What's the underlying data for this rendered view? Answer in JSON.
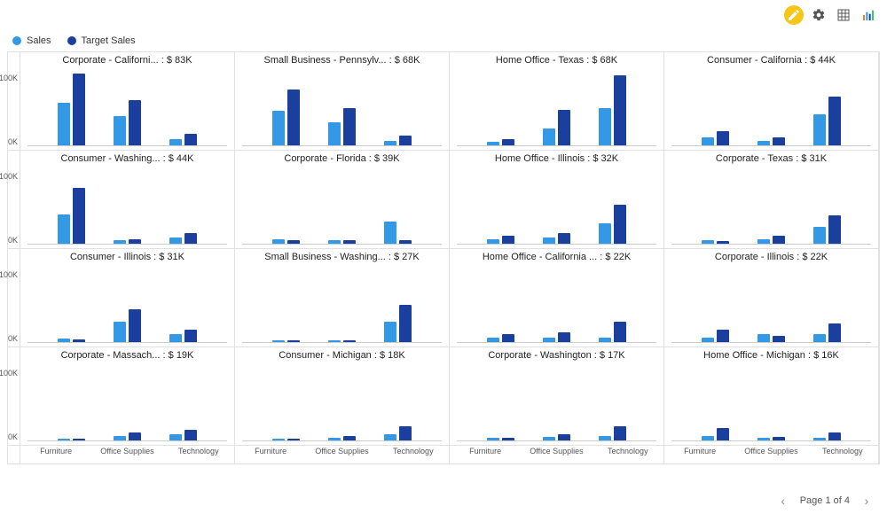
{
  "colors": {
    "sales": "#3399e6",
    "target": "#1b3f9c",
    "highlight": "#f5c518"
  },
  "legend": [
    {
      "label": "Sales",
      "color": "#3399e6"
    },
    {
      "label": "Target Sales",
      "color": "#1b3f9c"
    }
  ],
  "yaxis": {
    "max": 100,
    "ticks": [
      "100K",
      "0K"
    ]
  },
  "categories": [
    "Furniture",
    "Office Supplies",
    "Technology"
  ],
  "pager": {
    "label": "Page 1 of 4",
    "prev": "‹",
    "next": "›"
  },
  "chart_data": {
    "type": "bar",
    "layout": "small-multiples",
    "series_names": [
      "Sales",
      "Target Sales"
    ],
    "categories": [
      "Furniture",
      "Office Supplies",
      "Technology"
    ],
    "ylim": [
      0,
      100
    ],
    "yunit": "K",
    "panels": [
      {
        "title": "Corporate - Californi...",
        "value_label": "$ 83K",
        "series": [
          {
            "name": "Sales",
            "values": [
              55,
              38,
              8
            ]
          },
          {
            "name": "Target Sales",
            "values": [
              92,
              58,
              15
            ]
          }
        ]
      },
      {
        "title": "Small Business - Pennsylv...",
        "value_label": "$ 68K",
        "series": [
          {
            "name": "Sales",
            "values": [
              44,
              30,
              6
            ]
          },
          {
            "name": "Target Sales",
            "values": [
              72,
              48,
              12
            ]
          }
        ]
      },
      {
        "title": "Home Office - Texas",
        "value_label": "$ 68K",
        "series": [
          {
            "name": "Sales",
            "values": [
              4,
              22,
              48
            ]
          },
          {
            "name": "Target Sales",
            "values": [
              8,
              45,
              90
            ]
          }
        ]
      },
      {
        "title": "Consumer - California",
        "value_label": "$ 44K",
        "series": [
          {
            "name": "Sales",
            "values": [
              10,
              6,
              40
            ]
          },
          {
            "name": "Target Sales",
            "values": [
              18,
              10,
              62
            ]
          }
        ]
      },
      {
        "title": "Consumer - Washing...",
        "value_label": "$ 44K",
        "series": [
          {
            "name": "Sales",
            "values": [
              38,
              4,
              8
            ]
          },
          {
            "name": "Target Sales",
            "values": [
              72,
              6,
              14
            ]
          }
        ]
      },
      {
        "title": "Corporate - Florida",
        "value_label": "$ 39K",
        "series": [
          {
            "name": "Sales",
            "values": [
              6,
              5,
              28
            ]
          },
          {
            "name": "Target Sales",
            "values": [
              4,
              4,
              4
            ]
          }
        ]
      },
      {
        "title": "Home Office - Illinois",
        "value_label": "$ 32K",
        "series": [
          {
            "name": "Sales",
            "values": [
              6,
              8,
              26
            ]
          },
          {
            "name": "Target Sales",
            "values": [
              10,
              14,
              50
            ]
          }
        ]
      },
      {
        "title": "Corporate - Texas",
        "value_label": "$ 31K",
        "series": [
          {
            "name": "Sales",
            "values": [
              4,
              6,
              22
            ]
          },
          {
            "name": "Target Sales",
            "values": [
              3,
              10,
              36
            ]
          }
        ]
      },
      {
        "title": "Consumer - Illinois",
        "value_label": "$ 31K",
        "series": [
          {
            "name": "Sales",
            "values": [
              4,
              26,
              10
            ]
          },
          {
            "name": "Target Sales",
            "values": [
              3,
              42,
              16
            ]
          }
        ]
      },
      {
        "title": "Small Business - Washing...",
        "value_label": "$ 27K",
        "series": [
          {
            "name": "Sales",
            "values": [
              2,
              2,
              26
            ]
          },
          {
            "name": "Target Sales",
            "values": [
              2,
              2,
              48
            ]
          }
        ]
      },
      {
        "title": "Home Office - California ...",
        "value_label": "$ 22K",
        "series": [
          {
            "name": "Sales",
            "values": [
              6,
              6,
              6
            ]
          },
          {
            "name": "Target Sales",
            "values": [
              10,
              12,
              26
            ]
          }
        ]
      },
      {
        "title": "Corporate - Illinois",
        "value_label": "$ 22K",
        "series": [
          {
            "name": "Sales",
            "values": [
              6,
              10,
              10
            ]
          },
          {
            "name": "Target Sales",
            "values": [
              16,
              8,
              24
            ]
          }
        ]
      },
      {
        "title": "Corporate - Massach...",
        "value_label": "$ 19K",
        "series": [
          {
            "name": "Sales",
            "values": [
              2,
              6,
              8
            ]
          },
          {
            "name": "Target Sales",
            "values": [
              2,
              10,
              14
            ]
          }
        ]
      },
      {
        "title": "Consumer - Michigan",
        "value_label": "$ 18K",
        "series": [
          {
            "name": "Sales",
            "values": [
              2,
              3,
              8
            ]
          },
          {
            "name": "Target Sales",
            "values": [
              2,
              6,
              18
            ]
          }
        ]
      },
      {
        "title": "Corporate - Washington",
        "value_label": "$ 17K",
        "series": [
          {
            "name": "Sales",
            "values": [
              3,
              4,
              6
            ]
          },
          {
            "name": "Target Sales",
            "values": [
              3,
              8,
              18
            ]
          }
        ]
      },
      {
        "title": "Home Office - Michigan",
        "value_label": "$ 16K",
        "series": [
          {
            "name": "Sales",
            "values": [
              6,
              3,
              3
            ]
          },
          {
            "name": "Target Sales",
            "values": [
              16,
              4,
              10
            ]
          }
        ]
      }
    ]
  }
}
